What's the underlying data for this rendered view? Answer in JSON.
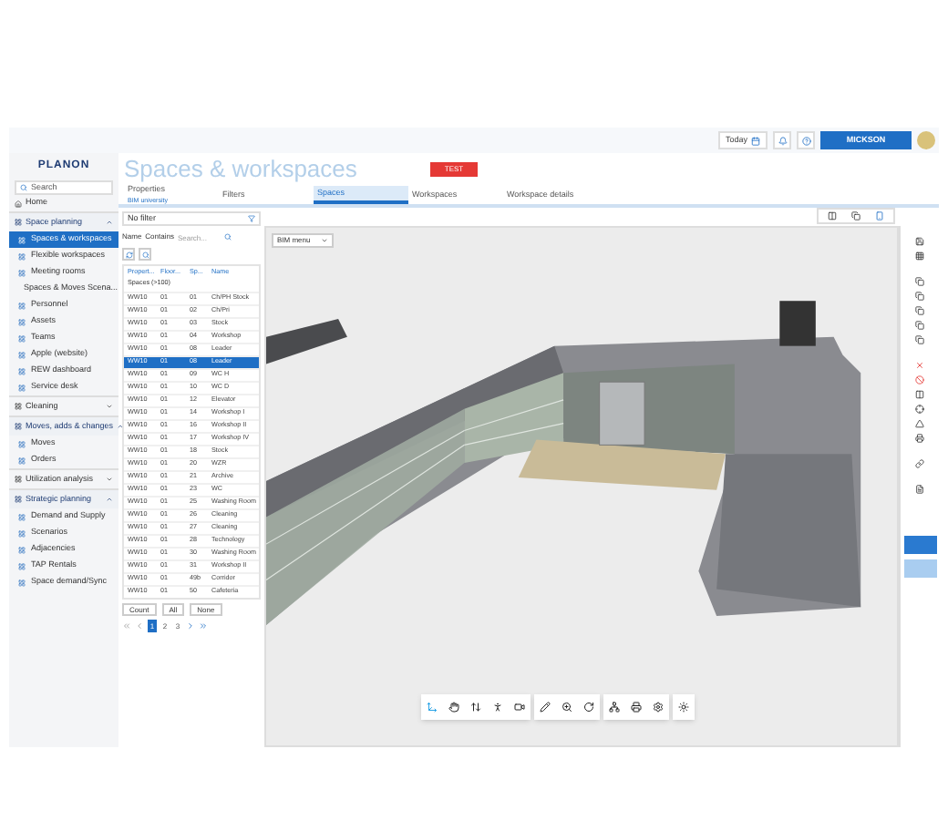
{
  "header": {
    "today": "Today",
    "user": "MICKSON"
  },
  "badge": "TEST",
  "sidebar": {
    "logo": "PLANON",
    "search": "Search",
    "home": "Home",
    "sections": [
      {
        "label": "Space planning",
        "expanded": true,
        "items": [
          {
            "label": "Spaces & workspaces",
            "selected": true
          },
          {
            "label": "Flexible workspaces",
            "selected": false
          },
          {
            "label": "Meeting rooms",
            "selected": false
          },
          {
            "label": "Spaces & Moves Scena...",
            "selected": false
          },
          {
            "label": "Personnel",
            "selected": false
          },
          {
            "label": "Assets",
            "selected": false
          },
          {
            "label": "Teams",
            "selected": false
          },
          {
            "label": "Apple (website)",
            "selected": false
          },
          {
            "label": "REW dashboard",
            "selected": false
          },
          {
            "label": "Service desk",
            "selected": false
          }
        ]
      },
      {
        "label": "Cleaning",
        "expanded": false
      },
      {
        "label": "Moves, adds & changes",
        "expanded": true,
        "items": [
          {
            "label": "Moves",
            "selected": false
          },
          {
            "label": "Orders",
            "selected": false
          }
        ]
      },
      {
        "label": "Utilization analysis",
        "expanded": false
      },
      {
        "label": "Strategic planning",
        "expanded": true,
        "items": [
          {
            "label": "Demand and Supply",
            "selected": false
          },
          {
            "label": "Scenarios",
            "selected": false
          },
          {
            "label": "Adjacencies",
            "selected": false
          },
          {
            "label": "TAP Rentals",
            "selected": false
          },
          {
            "label": "Space demand/Sync",
            "selected": false
          }
        ]
      }
    ]
  },
  "page_title": "Spaces & workspaces",
  "tabs": [
    {
      "label": "Properties",
      "sublabel": "BIM university",
      "selected": false
    },
    {
      "label": "Filters",
      "selected": false
    },
    {
      "label": "Spaces",
      "selected": true
    },
    {
      "label": "Workspaces",
      "selected": false
    },
    {
      "label": "Workspace details",
      "selected": false
    }
  ],
  "filter": {
    "value": "No filter"
  },
  "search": {
    "field": "Name",
    "operator": "Contains",
    "placeholder": "Search..."
  },
  "table": {
    "columns": [
      "Propert...",
      "Floor...",
      "Sp...",
      "Name"
    ],
    "group": "Spaces (>100)",
    "rows": [
      {
        "cells": [
          "WW10",
          "01",
          "01",
          "Ch/PH Stock"
        ],
        "selected": false
      },
      {
        "cells": [
          "WW10",
          "01",
          "02",
          "Ch/Pri"
        ],
        "selected": false
      },
      {
        "cells": [
          "WW10",
          "01",
          "03",
          "Stock"
        ],
        "selected": false
      },
      {
        "cells": [
          "WW10",
          "01",
          "04",
          "Workshop"
        ],
        "selected": false
      },
      {
        "cells": [
          "WW10",
          "01",
          "08",
          "Leader"
        ],
        "selected": false
      },
      {
        "cells": [
          "WW10",
          "01",
          "08",
          "Leader"
        ],
        "selected": true
      },
      {
        "cells": [
          "WW10",
          "01",
          "09",
          "WC H"
        ],
        "selected": false
      },
      {
        "cells": [
          "WW10",
          "01",
          "10",
          "WC D"
        ],
        "selected": false
      },
      {
        "cells": [
          "WW10",
          "01",
          "12",
          "Elevator"
        ],
        "selected": false
      },
      {
        "cells": [
          "WW10",
          "01",
          "14",
          "Workshop I"
        ],
        "selected": false
      },
      {
        "cells": [
          "WW10",
          "01",
          "16",
          "Workshop II"
        ],
        "selected": false
      },
      {
        "cells": [
          "WW10",
          "01",
          "17",
          "Workshop IV"
        ],
        "selected": false
      },
      {
        "cells": [
          "WW10",
          "01",
          "18",
          "Stock"
        ],
        "selected": false
      },
      {
        "cells": [
          "WW10",
          "01",
          "20",
          "WZR"
        ],
        "selected": false
      },
      {
        "cells": [
          "WW10",
          "01",
          "21",
          "Archive"
        ],
        "selected": false
      },
      {
        "cells": [
          "WW10",
          "01",
          "23",
          "WC"
        ],
        "selected": false
      },
      {
        "cells": [
          "WW10",
          "01",
          "25",
          "Washing Room"
        ],
        "selected": false
      },
      {
        "cells": [
          "WW10",
          "01",
          "26",
          "Cleaning"
        ],
        "selected": false
      },
      {
        "cells": [
          "WW10",
          "01",
          "27",
          "Cleaning"
        ],
        "selected": false
      },
      {
        "cells": [
          "WW10",
          "01",
          "28",
          "Technology"
        ],
        "selected": false
      },
      {
        "cells": [
          "WW10",
          "01",
          "30",
          "Washing Room"
        ],
        "selected": false
      },
      {
        "cells": [
          "WW10",
          "01",
          "31",
          "Workshop II"
        ],
        "selected": false
      },
      {
        "cells": [
          "WW10",
          "01",
          "49b",
          "Corridor"
        ],
        "selected": false
      },
      {
        "cells": [
          "WW10",
          "01",
          "50",
          "Cafeteria"
        ],
        "selected": false
      }
    ]
  },
  "list_buttons": [
    "Count",
    "All",
    "None"
  ],
  "pagination": [
    {
      "label": "1",
      "selected": true
    },
    {
      "label": "2",
      "selected": false
    },
    {
      "label": "3",
      "selected": false
    }
  ],
  "viewer": {
    "menu": "BIM menu"
  }
}
